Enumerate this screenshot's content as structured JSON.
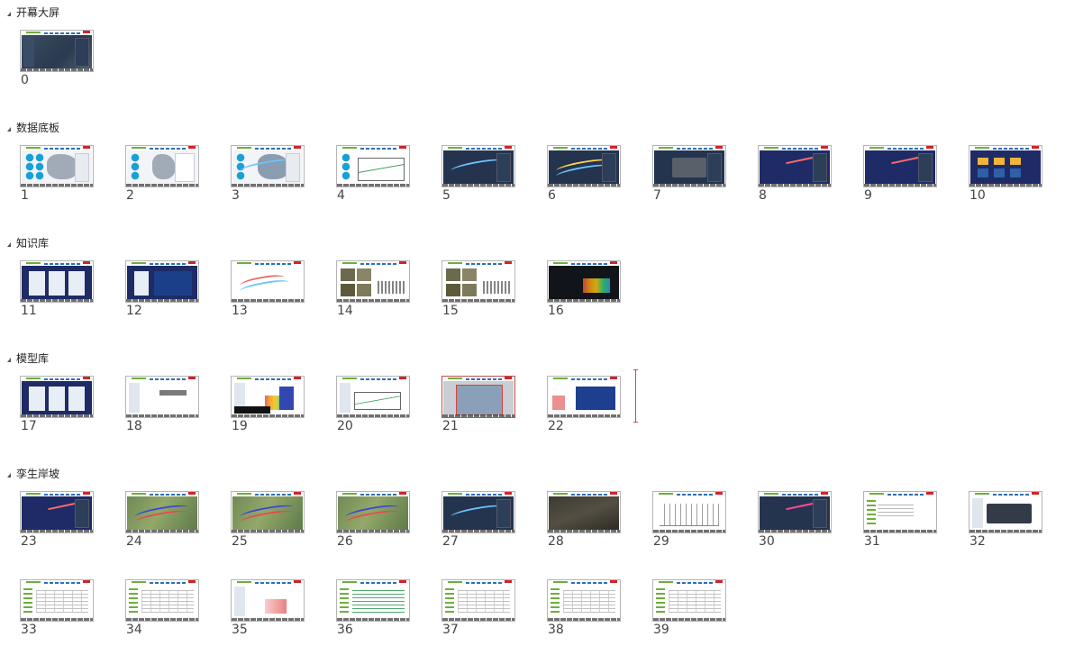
{
  "sections": [
    {
      "title": "开幕大屏",
      "slides": [
        {
          "num": "0",
          "theme": "opening"
        }
      ]
    },
    {
      "title": "数据底板",
      "slides": [
        {
          "num": "1",
          "theme": "circles"
        },
        {
          "num": "2",
          "theme": "circles-panel"
        },
        {
          "num": "3",
          "theme": "circles-river"
        },
        {
          "num": "4",
          "theme": "circles-chart"
        },
        {
          "num": "5",
          "theme": "dark"
        },
        {
          "num": "6",
          "theme": "dark-river"
        },
        {
          "num": "7",
          "theme": "dark-scene"
        },
        {
          "num": "8",
          "theme": "navy-glow"
        },
        {
          "num": "9",
          "theme": "navy-glow"
        },
        {
          "num": "10",
          "theme": "dark-grid"
        }
      ]
    },
    {
      "title": "知识库",
      "slides": [
        {
          "num": "11",
          "theme": "navy-cards"
        },
        {
          "num": "12",
          "theme": "navy-cards2"
        },
        {
          "num": "13",
          "theme": "white-map"
        },
        {
          "num": "14",
          "theme": "photos-table"
        },
        {
          "num": "15",
          "theme": "photos-table"
        },
        {
          "num": "16",
          "theme": "black-rainbow"
        }
      ]
    },
    {
      "title": "模型库",
      "slides": [
        {
          "num": "17",
          "theme": "navy-cards"
        },
        {
          "num": "18",
          "theme": "white-sidebar"
        },
        {
          "num": "19",
          "theme": "white-rainbow"
        },
        {
          "num": "20",
          "theme": "white-chart"
        },
        {
          "num": "21",
          "theme": "grey-frame"
        },
        {
          "num": "22",
          "theme": "white-blue"
        }
      ]
    },
    {
      "title": "孪生岸坡",
      "slides": [
        {
          "num": "23",
          "theme": "navy-glow"
        },
        {
          "num": "24",
          "theme": "map"
        },
        {
          "num": "25",
          "theme": "map"
        },
        {
          "num": "26",
          "theme": "map"
        },
        {
          "num": "27",
          "theme": "dark"
        },
        {
          "num": "28",
          "theme": "photo"
        },
        {
          "num": "29",
          "theme": "bridge"
        },
        {
          "num": "30",
          "theme": "dark-glow"
        },
        {
          "num": "31",
          "theme": "white-text"
        },
        {
          "num": "32",
          "theme": "white-dark-panel"
        },
        {
          "num": "33",
          "theme": "white-table"
        },
        {
          "num": "34",
          "theme": "white-table"
        },
        {
          "num": "35",
          "theme": "white-rainbow2"
        },
        {
          "num": "36",
          "theme": "white-green"
        },
        {
          "num": "37",
          "theme": "white-table"
        },
        {
          "num": "38",
          "theme": "white-table"
        },
        {
          "num": "39",
          "theme": "white-table"
        }
      ]
    }
  ],
  "selected_slide": "21",
  "colors": {
    "selection": "#c0504d",
    "brand_red": "#d2232a",
    "brand_green": "#6fae3c",
    "brand_blue": "#2d6fb8"
  }
}
